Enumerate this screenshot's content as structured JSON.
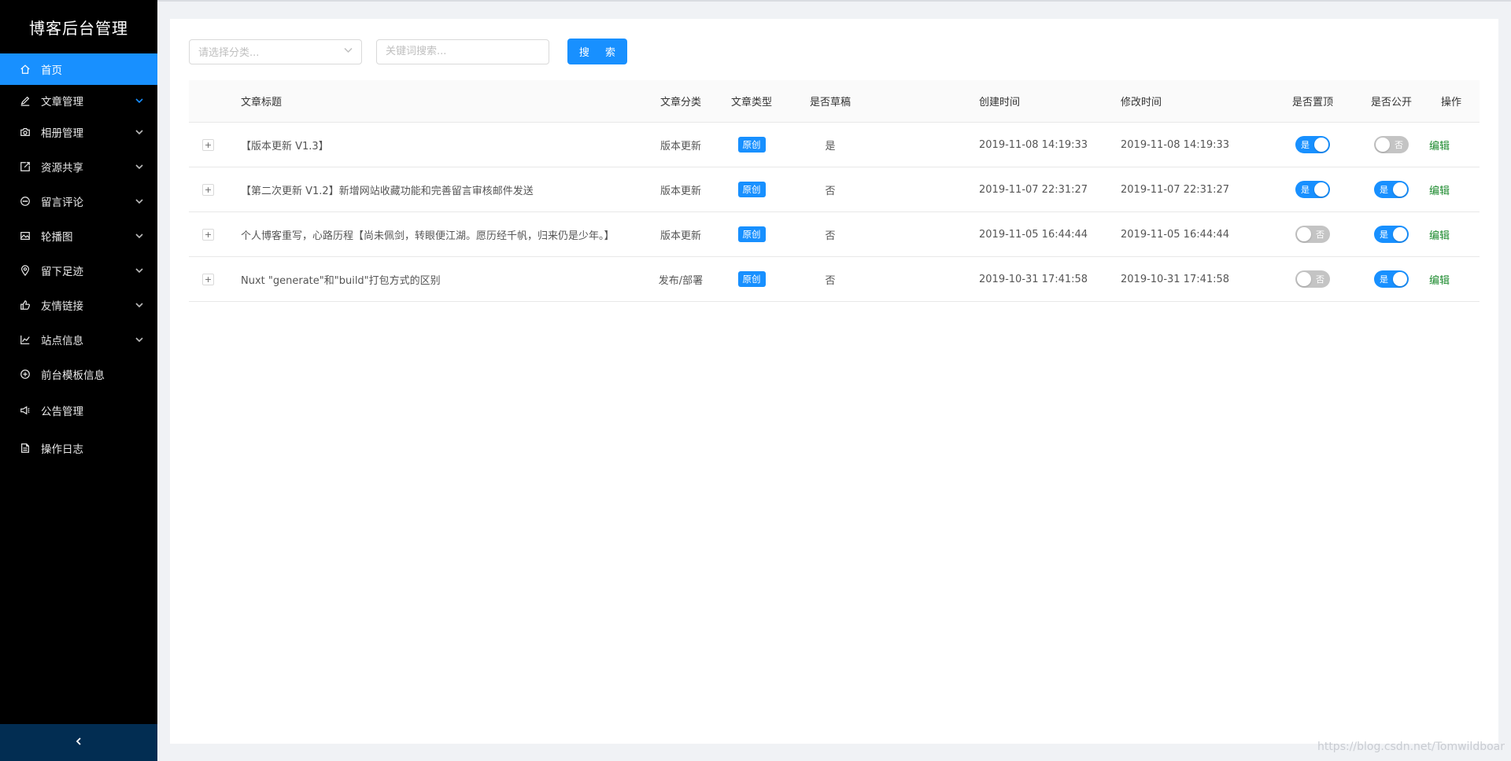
{
  "app": {
    "title": "博客后台管理"
  },
  "sidebar": {
    "items": [
      {
        "label": "首页",
        "icon": "home-icon",
        "active": true,
        "has_arrow": false
      },
      {
        "label": "文章管理",
        "icon": "edit-icon",
        "has_arrow": true,
        "open": true
      },
      {
        "label": "相册管理",
        "icon": "camera-icon",
        "has_arrow": true
      },
      {
        "label": "资源共享",
        "icon": "share-icon",
        "has_arrow": true
      },
      {
        "label": "留言评论",
        "icon": "comment-icon",
        "has_arrow": true
      },
      {
        "label": "轮播图",
        "icon": "picture-icon",
        "has_arrow": true
      },
      {
        "label": "留下足迹",
        "icon": "location-icon",
        "has_arrow": true
      },
      {
        "label": "友情链接",
        "icon": "like-icon",
        "has_arrow": true
      },
      {
        "label": "站点信息",
        "icon": "chart-icon",
        "has_arrow": true
      },
      {
        "label": "前台模板信息",
        "icon": "plus-circle-icon",
        "has_arrow": false
      },
      {
        "label": "公告管理",
        "icon": "sound-icon",
        "has_arrow": false
      },
      {
        "label": "操作日志",
        "icon": "file-icon",
        "has_arrow": false
      }
    ],
    "collapse_icon": "chevron-left-icon"
  },
  "toolbar": {
    "category_placeholder": "请选择分类...",
    "keyword_placeholder": "关键词搜索...",
    "search_label": "搜 索"
  },
  "table": {
    "columns": {
      "title": "文章标题",
      "category": "文章分类",
      "type": "文章类型",
      "draft": "是否草稿",
      "created": "创建时间",
      "modified": "修改时间",
      "top": "是否置顶",
      "public": "是否公开",
      "action": "操作"
    },
    "rows": [
      {
        "title": "【版本更新 V1.3】",
        "category": "版本更新",
        "type": "原创",
        "draft": "是",
        "created": "2019-11-08 14:19:33",
        "modified": "2019-11-08 14:19:33",
        "top": true,
        "top_label": "是",
        "public": false,
        "public_label": "否",
        "action": "编辑"
      },
      {
        "title": "【第二次更新 V1.2】新增网站收藏功能和完善留言审核邮件发送",
        "category": "版本更新",
        "type": "原创",
        "draft": "否",
        "created": "2019-11-07 22:31:27",
        "modified": "2019-11-07 22:31:27",
        "top": true,
        "top_label": "是",
        "public": true,
        "public_label": "是",
        "action": "编辑"
      },
      {
        "title": "个人博客重写，心路历程【尚未佩剑，转眼便江湖。愿历经千帆，归来仍是少年。】",
        "category": "版本更新",
        "type": "原创",
        "draft": "否",
        "created": "2019-11-05 16:44:44",
        "modified": "2019-11-05 16:44:44",
        "top": false,
        "top_label": "否",
        "public": true,
        "public_label": "是",
        "action": "编辑"
      },
      {
        "title": "Nuxt \"generate\"和\"build\"打包方式的区别",
        "category": "发布/部署",
        "type": "原创",
        "draft": "否",
        "created": "2019-10-31 17:41:58",
        "modified": "2019-10-31 17:41:58",
        "top": false,
        "top_label": "否",
        "public": true,
        "public_label": "是",
        "action": "编辑"
      }
    ]
  },
  "watermark": "https://blog.csdn.net/Tomwildboar",
  "colors": {
    "primary": "#1890ff",
    "sidebar_bg": "#000000",
    "collapse_bg": "#022d52",
    "edit_link": "#1c8a2e"
  }
}
